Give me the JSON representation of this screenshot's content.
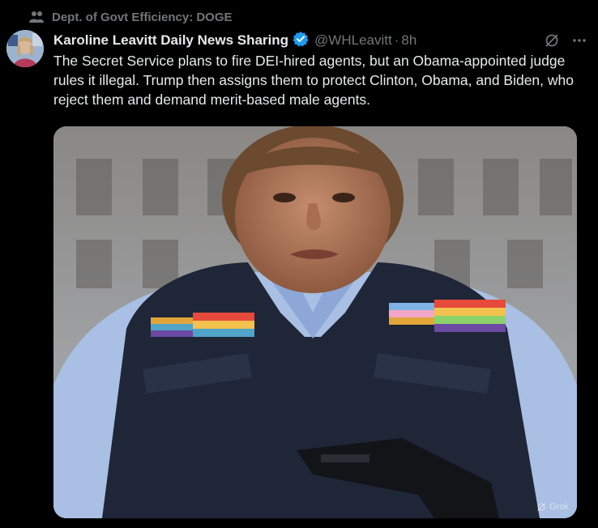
{
  "context": {
    "community_label": "Dept. of Govt Efficiency: DOGE",
    "icon": "community-icon"
  },
  "post": {
    "author": {
      "display_name": "Karoline Leavitt Daily News Sharing",
      "handle": "@WHLeavitt",
      "separator": "·",
      "time": "8h",
      "verified_icon": "verified-badge-icon",
      "verified_color": "#1d9bf0"
    },
    "text": "The Secret Service plans to fire DEI-hired agents, but an Obama-appointed judge rules it illegal. Trump then assigns them to protect Clinton, Obama, and Biden, who reject them and demand merit-based male agents.",
    "actions": {
      "grok_icon": "grok-icon",
      "more_icon": "more-icon"
    },
    "media": {
      "type": "image",
      "watermark": "Grok"
    }
  },
  "colors": {
    "background": "#000000",
    "primary_text": "#e7e9ea",
    "secondary_text": "#71767b"
  }
}
